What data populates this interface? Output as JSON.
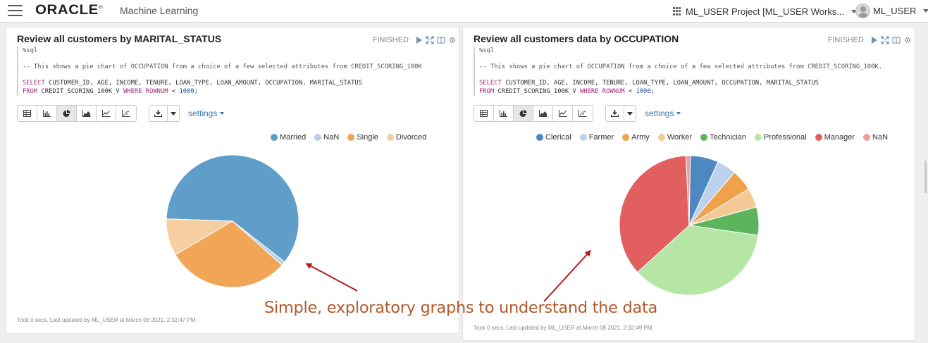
{
  "topbar": {
    "brand": "ORACLE",
    "brand_reg": "®",
    "product": "Machine Learning",
    "project": "ML_USER Project [ML_USER Works...",
    "user": "ML_USER"
  },
  "panels": [
    {
      "title": "Review all customers by MARITAL_STATUS",
      "status": "FINISHED",
      "code_line1": "%sql",
      "code_line2": "-- This shows a pie chart of OCCUPATION from a choice of a few selected attributes from CREDIT_SCORING_100K",
      "code_select_kw": "SELECT",
      "code_select_rest": " CUSTOMER_ID, AGE, INCOME, TENURE, LOAN_TYPE, LOAN_AMOUNT, OCCUPATION, MARITAL_STATUS",
      "code_from_kw": "FROM",
      "code_from_mid": " CREDIT_SCORING_100K_V ",
      "code_where_kw": "WHERE ROWNUM",
      "code_lt": " < ",
      "code_num": "1000",
      "code_end": ";",
      "settings": "settings",
      "footer": "Took 0 secs. Last updated by ML_USER at March 08 2021, 2:32:47 PM."
    },
    {
      "title": "Review all customers data by OCCUPATION",
      "status": "FINISHED",
      "code_line1": "%sql",
      "code_line2": "-- This shows a pie chart of OCCUPATION from a choice of a few selected attributes from CREDIT_SCORING_100K.",
      "code_select_kw": "SELECT",
      "code_select_rest": " CUSTOMER_ID, AGE, INCOME, TENURE, LOAN_TYPE, LOAN_AMOUNT, OCCUPATION, MARITAL_STATUS",
      "code_from_kw": "FROM",
      "code_from_mid": " CREDIT_SCORING_100K_V ",
      "code_where_kw": "WHERE ROWNUM",
      "code_lt": " < ",
      "code_num": "1000",
      "code_end": ";",
      "settings": "settings",
      "footer": "Took 0 secs. Last updated by ML_USER at March 08 2021, 2:32:49 PM."
    }
  ],
  "annotation": "Simple, exploratory graphs to understand the data",
  "icons": {
    "status": [
      "play-icon",
      "expand-icon",
      "book-icon",
      "gear-icon"
    ],
    "view_buttons": [
      "table-icon",
      "bar-chart-icon",
      "pie-chart-icon",
      "area-chart-icon",
      "line-chart-icon",
      "scatter-chart-icon"
    ],
    "download": "download-icon"
  },
  "chart_data": [
    {
      "type": "pie",
      "title": "",
      "labels": [
        "Married",
        "NaN",
        "Single",
        "Divorced"
      ],
      "values": [
        60,
        1,
        30,
        9
      ],
      "colors": [
        "#5f9ec9",
        "#b8cfe8",
        "#f0a656",
        "#f5cfa0"
      ],
      "legend": "top"
    },
    {
      "type": "pie",
      "title": "",
      "labels": [
        "Clerical",
        "Farmer",
        "Army",
        "Worker",
        "Technician",
        "Professional",
        "Manager",
        "NaN"
      ],
      "values": [
        6.5,
        4.5,
        5,
        4.5,
        6.5,
        36,
        36,
        1
      ],
      "colors": [
        "#4e88c1",
        "#bcd1ec",
        "#f0a14c",
        "#f5c896",
        "#5cb55c",
        "#b5e6a5",
        "#e15f5f",
        "#f19c9c"
      ],
      "legend": "top"
    }
  ]
}
